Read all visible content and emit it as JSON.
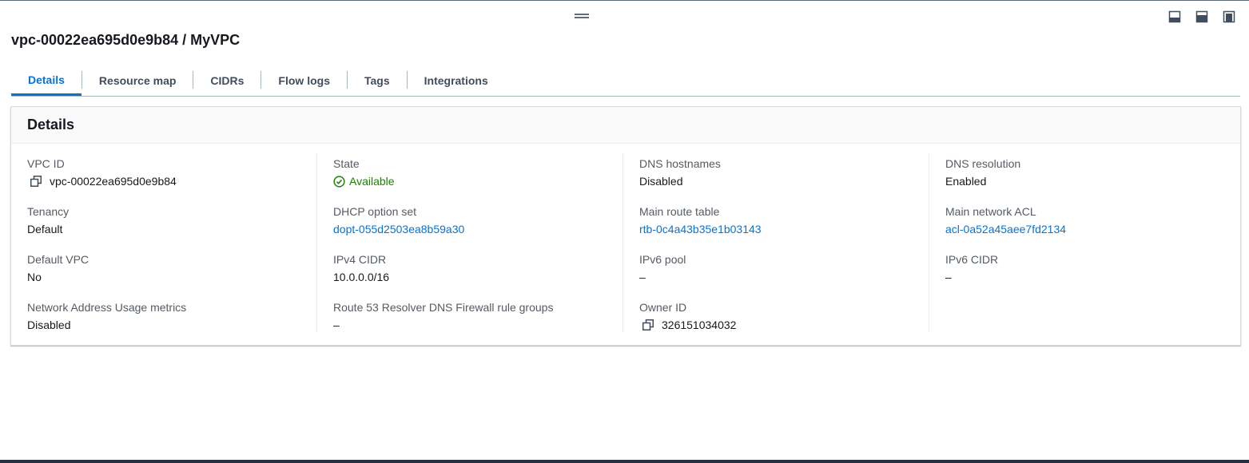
{
  "title": "vpc-00022ea695d0e9b84 / MyVPC",
  "tabs": [
    {
      "label": "Details",
      "active": true
    },
    {
      "label": "Resource map",
      "active": false
    },
    {
      "label": "CIDRs",
      "active": false
    },
    {
      "label": "Flow logs",
      "active": false
    },
    {
      "label": "Tags",
      "active": false
    },
    {
      "label": "Integrations",
      "active": false
    }
  ],
  "details": {
    "header": "Details",
    "columns": [
      [
        {
          "label": "VPC ID",
          "value": "vpc-00022ea695d0e9b84",
          "copyable": true
        },
        {
          "label": "Tenancy",
          "value": "Default"
        },
        {
          "label": "Default VPC",
          "value": "No"
        },
        {
          "label": "Network Address Usage metrics",
          "value": "Disabled"
        }
      ],
      [
        {
          "label": "State",
          "value": "Available",
          "status": "success"
        },
        {
          "label": "DHCP option set",
          "value": "dopt-055d2503ea8b59a30",
          "link": true
        },
        {
          "label": "IPv4 CIDR",
          "value": "10.0.0.0/16"
        },
        {
          "label": "Route 53 Resolver DNS Firewall rule groups",
          "value": "–"
        }
      ],
      [
        {
          "label": "DNS hostnames",
          "value": "Disabled"
        },
        {
          "label": "Main route table",
          "value": "rtb-0c4a43b35e1b03143",
          "link": true
        },
        {
          "label": "IPv6 pool",
          "value": "–"
        },
        {
          "label": "Owner ID",
          "value": "326151034032",
          "copyable": true
        }
      ],
      [
        {
          "label": "DNS resolution",
          "value": "Enabled"
        },
        {
          "label": "Main network ACL",
          "value": "acl-0a52a45aee7fd2134",
          "link": true
        },
        {
          "label": "IPv6 CIDR",
          "value": "–"
        }
      ]
    ]
  },
  "icons": {
    "copy": "copy-icon",
    "status_available": "status-positive-icon",
    "pane_controls": [
      "split-bottom-icon",
      "split-side-icon",
      "maximize-icon"
    ],
    "drag_handle": "drag-handle-icon"
  },
  "colors": {
    "link": "#0972d3",
    "success": "#1d8102",
    "text": "#16191f",
    "label": "#545b64"
  }
}
